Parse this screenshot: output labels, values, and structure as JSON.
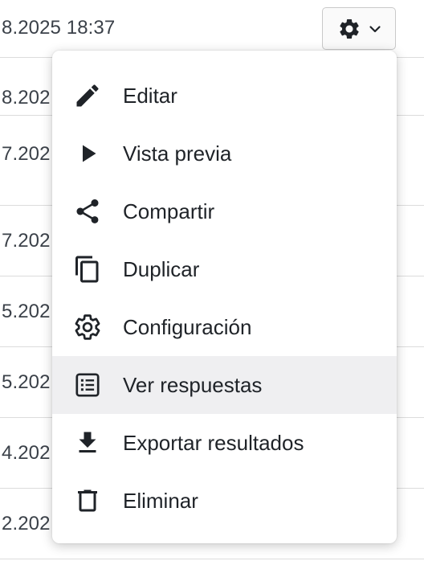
{
  "background_rows": [
    {
      "date": "8.2025 18:37"
    },
    {
      "date": "8.202"
    },
    {
      "date": "7.202"
    },
    {
      "date": "7.202"
    },
    {
      "date": "5.202"
    },
    {
      "date": "5.202"
    },
    {
      "date": "4.202"
    },
    {
      "date": "2.202"
    }
  ],
  "gear_button": {
    "icon": "gear-icon",
    "caret": "chevron-down-icon"
  },
  "menu": {
    "items": [
      {
        "label": "Editar",
        "icon": "pencil-icon"
      },
      {
        "label": "Vista previa",
        "icon": "play-icon"
      },
      {
        "label": "Compartir",
        "icon": "share-icon"
      },
      {
        "label": "Duplicar",
        "icon": "copy-icon"
      },
      {
        "label": "Configuración",
        "icon": "gear-icon"
      },
      {
        "label": "Ver respuestas",
        "icon": "list-icon",
        "highlighted": true
      },
      {
        "label": "Exportar resultados",
        "icon": "download-icon"
      },
      {
        "label": "Eliminar",
        "icon": "trash-icon"
      }
    ]
  },
  "colors": {
    "text": "#1f2328",
    "highlight": "#efeff1",
    "divider": "#dcdcdc"
  }
}
